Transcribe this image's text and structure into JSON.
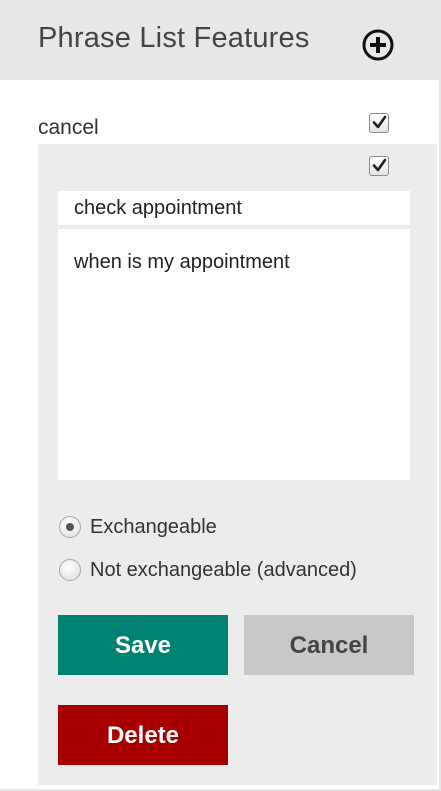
{
  "header": {
    "title": "Phrase List Features",
    "add_icon": "plus-circle-icon"
  },
  "feature": {
    "name": "cancel",
    "enabled": true
  },
  "editor": {
    "active": true,
    "name_value": "check appointment",
    "values_text": "when is my appointment",
    "options": [
      {
        "label": "Exchangeable",
        "selected": true
      },
      {
        "label": "Not exchangeable (advanced)",
        "selected": false
      }
    ],
    "save_label": "Save",
    "cancel_label": "Cancel",
    "delete_label": "Delete"
  },
  "colors": {
    "save": "#008272",
    "cancel": "#c8c8c8",
    "delete": "#a80000",
    "header_bg": "#e7e7e7",
    "panel_bg": "#ececec"
  }
}
